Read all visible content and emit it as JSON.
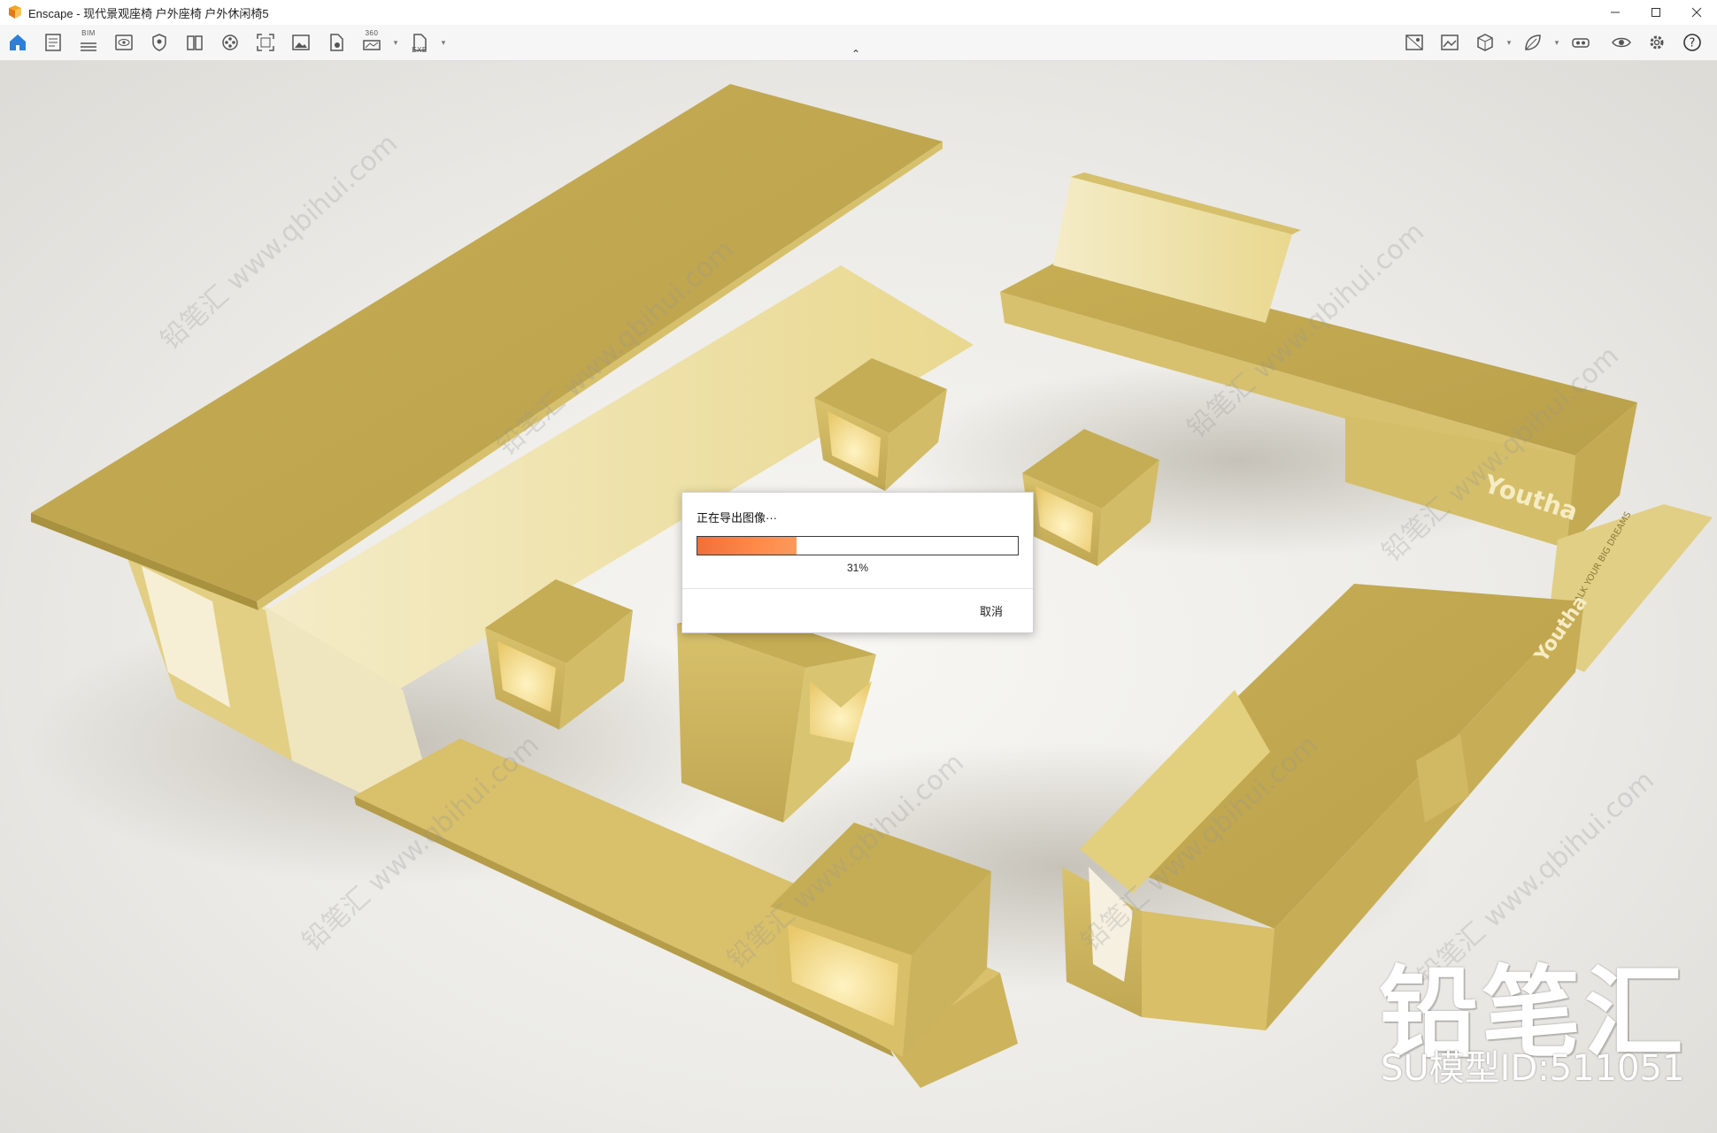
{
  "window": {
    "title": "Enscape - 现代景观座椅 户外座椅 户外休闲椅5",
    "controls": [
      "minimize",
      "maximize",
      "close"
    ]
  },
  "toolbar": {
    "left_tools": [
      {
        "icon": "home-icon",
        "active": true
      },
      {
        "icon": "document-icon"
      },
      {
        "icon": "bim-icon",
        "label": "BIM"
      },
      {
        "icon": "view-icon"
      },
      {
        "icon": "shield-icon"
      },
      {
        "icon": "book-icon"
      },
      {
        "icon": "film-reel-icon"
      },
      {
        "icon": "screenshot-icon"
      },
      {
        "icon": "image-icon"
      },
      {
        "icon": "file-badge-icon"
      },
      {
        "icon": "panorama-360-icon",
        "label": "360",
        "has_dropdown": true
      },
      {
        "icon": "exe-export-icon",
        "label": "EXE",
        "has_dropdown": true
      }
    ],
    "right_tools": [
      {
        "icon": "asset-library-icon"
      },
      {
        "icon": "material-editor-icon"
      },
      {
        "icon": "cube-icon",
        "has_dropdown": true
      },
      {
        "icon": "leaf-icon",
        "has_dropdown": true
      },
      {
        "icon": "vr-headset-icon"
      },
      {
        "icon": "eye-icon"
      },
      {
        "icon": "settings-icon"
      },
      {
        "icon": "help-icon"
      }
    ]
  },
  "dialog": {
    "title": "正在导出图像···",
    "progress": 0.31,
    "progress_text": "31%",
    "cancel_label": "取消"
  },
  "scene": {
    "sign_text_1": "Youtha",
    "sign_text_2": "Youtha",
    "plate_text": "WALK YOUR BIG DREAMS"
  },
  "watermark": {
    "brand": "铅笔汇",
    "model_id": "SU模型ID:511051",
    "tile_text": "铅笔汇 www.qbihui.com"
  },
  "colors": {
    "gold": "#c9b156",
    "gold_light": "#ecd98e",
    "gold_shadow": "#a89244",
    "progress_orange": "#f0703a"
  }
}
